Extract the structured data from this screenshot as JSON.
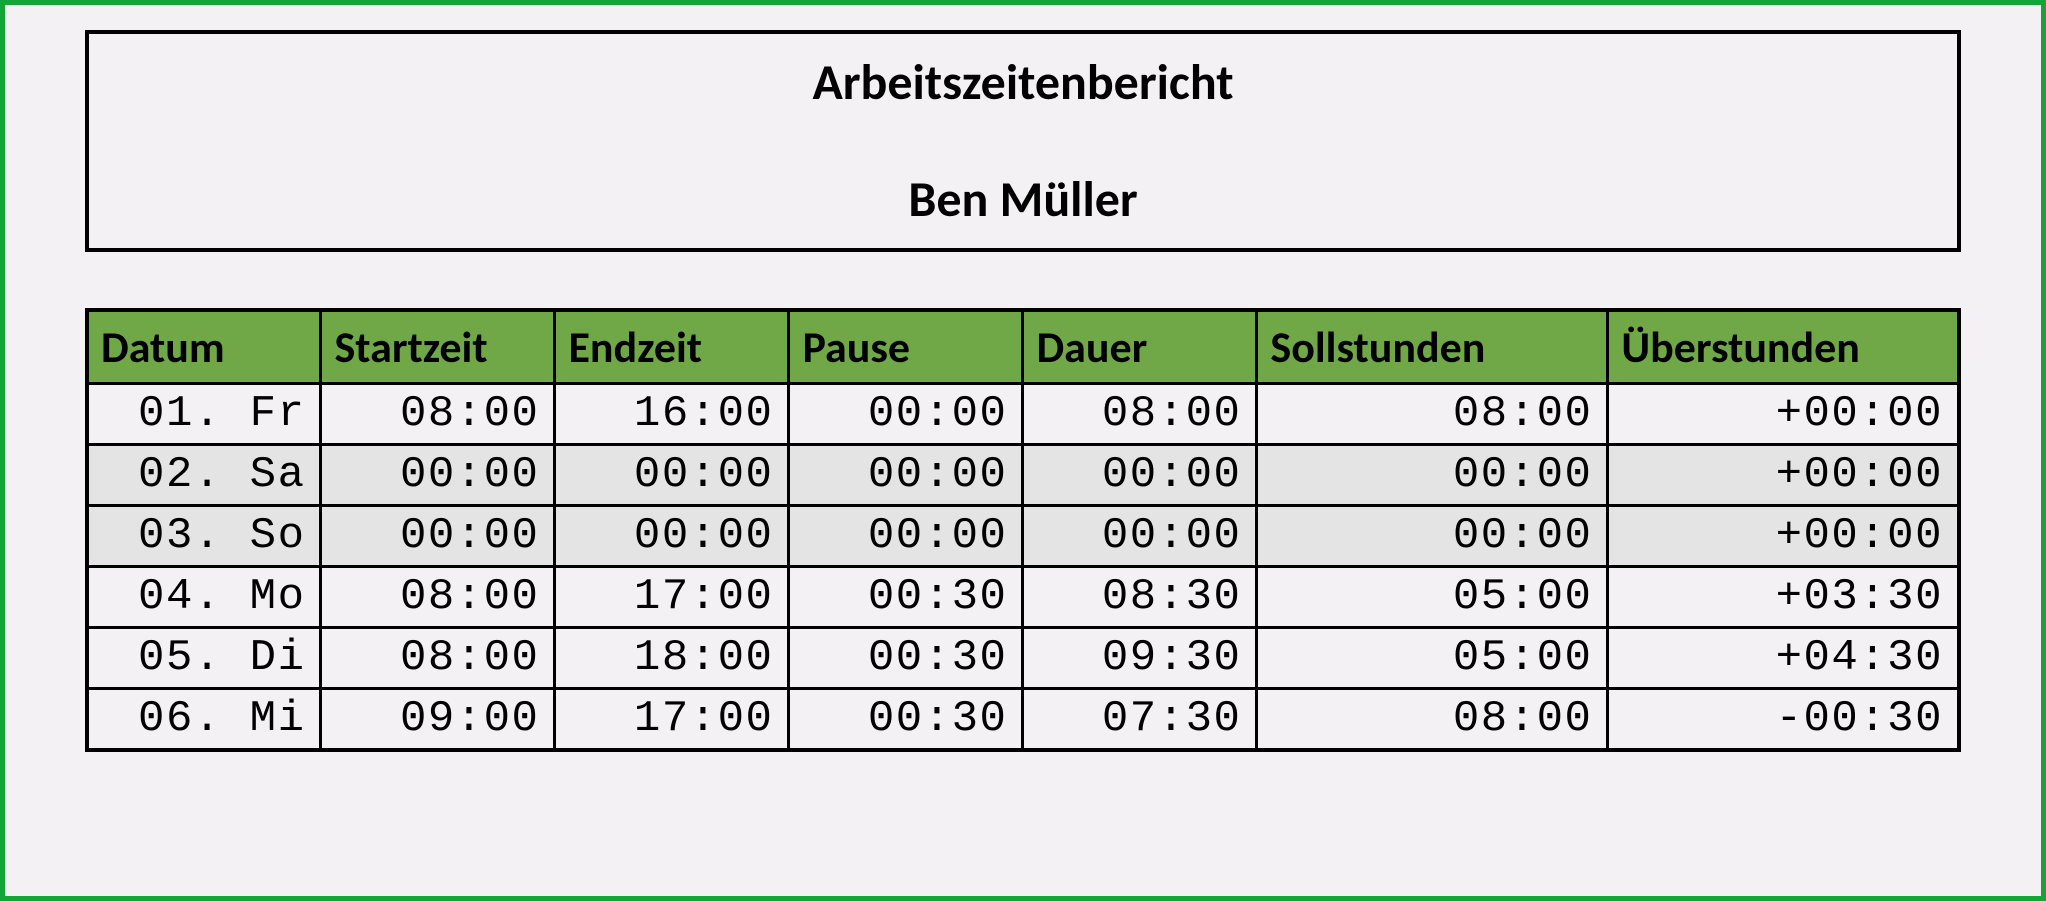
{
  "header": {
    "title": "Arbeitszeitenbericht",
    "person": "Ben Müller"
  },
  "columns": {
    "datum": "Datum",
    "startzeit": "Startzeit",
    "endzeit": "Endzeit",
    "pause": "Pause",
    "dauer": "Dauer",
    "sollstunden": "Sollstunden",
    "ueberstunden": "Überstunden"
  },
  "rows": [
    {
      "datum": "01. Fr",
      "startzeit": "08:00",
      "endzeit": "16:00",
      "pause": "00:00",
      "dauer": "08:00",
      "sollstunden": "08:00",
      "ueberstunden": "+00:00",
      "weekend": false
    },
    {
      "datum": "02. Sa",
      "startzeit": "00:00",
      "endzeit": "00:00",
      "pause": "00:00",
      "dauer": "00:00",
      "sollstunden": "00:00",
      "ueberstunden": "+00:00",
      "weekend": true
    },
    {
      "datum": "03. So",
      "startzeit": "00:00",
      "endzeit": "00:00",
      "pause": "00:00",
      "dauer": "00:00",
      "sollstunden": "00:00",
      "ueberstunden": "+00:00",
      "weekend": true
    },
    {
      "datum": "04. Mo",
      "startzeit": "08:00",
      "endzeit": "17:00",
      "pause": "00:30",
      "dauer": "08:30",
      "sollstunden": "05:00",
      "ueberstunden": "+03:30",
      "weekend": false
    },
    {
      "datum": "05. Di",
      "startzeit": "08:00",
      "endzeit": "18:00",
      "pause": "00:30",
      "dauer": "09:30",
      "sollstunden": "05:00",
      "ueberstunden": "+04:30",
      "weekend": false
    },
    {
      "datum": "06. Mi",
      "startzeit": "09:00",
      "endzeit": "17:00",
      "pause": "00:30",
      "dauer": "07:30",
      "sollstunden": "08:00",
      "ueberstunden": "-00:30",
      "weekend": false
    }
  ]
}
